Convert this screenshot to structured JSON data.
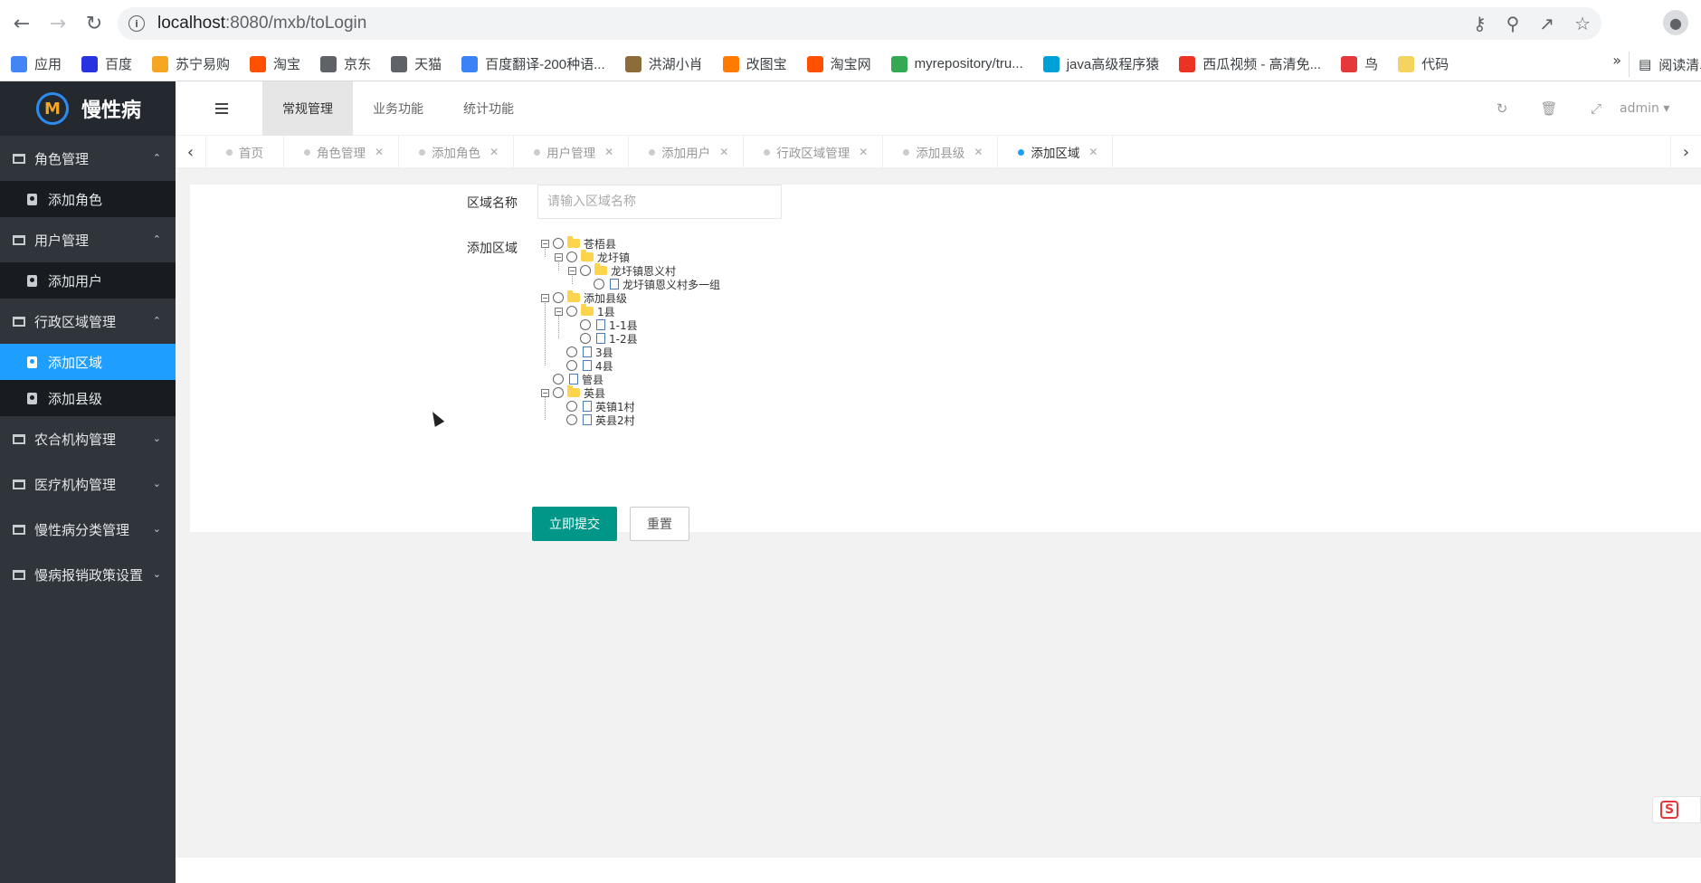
{
  "browser": {
    "url_host": "localhost",
    "url_path": ":8080/mxb/toLogin",
    "bookmarks": [
      {
        "label": "应用",
        "color": "#4285f4",
        "icon": "apps-icon"
      },
      {
        "label": "百度",
        "color": "#2932e1",
        "icon": "baidu-paw-icon"
      },
      {
        "label": "苏宁易购",
        "color": "#f5a623",
        "icon": "suning-icon"
      },
      {
        "label": "淘宝",
        "color": "#ff5000",
        "icon": "taobao-icon"
      },
      {
        "label": "京东",
        "color": "#5f6368",
        "icon": "globe-icon"
      },
      {
        "label": "天猫",
        "color": "#5f6368",
        "icon": "globe-icon"
      },
      {
        "label": "百度翻译-200种语...",
        "color": "#3b82f6",
        "icon": "translate-icon"
      },
      {
        "label": "洪湖小肖",
        "color": "#8a6d3b",
        "icon": "bird-icon"
      },
      {
        "label": "改图宝",
        "color": "#ff7a00",
        "icon": "image-edit-icon"
      },
      {
        "label": "淘宝网",
        "color": "#ff5000",
        "icon": "taobao-icon"
      },
      {
        "label": "myrepository/tru...",
        "color": "#34a853",
        "icon": "chrome-icon"
      },
      {
        "label": "java高级程序猿",
        "color": "#00a1d6",
        "icon": "bilibili-icon"
      },
      {
        "label": "西瓜视频 - 高清免...",
        "color": "#ea3323",
        "icon": "play-icon"
      },
      {
        "label": "鸟",
        "color": "#e5383b",
        "icon": "bird-icon"
      },
      {
        "label": "代码",
        "color": "#f4d35e",
        "icon": "moon-icon"
      }
    ],
    "more_label": "»",
    "reading_list_label": "阅读清单"
  },
  "app": {
    "logo_mark": "M",
    "logo_text": "慢性病",
    "sidebar": [
      {
        "label": "角色管理",
        "expanded": true,
        "children": [
          "添加角色"
        ]
      },
      {
        "label": "用户管理",
        "expanded": true,
        "children": [
          "添加用户"
        ]
      },
      {
        "label": "行政区域管理",
        "expanded": true,
        "children": [
          "添加区域",
          "添加县级"
        ]
      },
      {
        "label": "农合机构管理",
        "expanded": false,
        "children": []
      },
      {
        "label": "医疗机构管理",
        "expanded": false,
        "children": []
      },
      {
        "label": "慢性病分类管理",
        "expanded": false,
        "children": []
      },
      {
        "label": "慢病报销政策设置",
        "expanded": false,
        "children": []
      }
    ],
    "active_child": "添加区域",
    "top_tabs": [
      "常规管理",
      "业务功能",
      "统计功能"
    ],
    "admin_label": "admin",
    "page_tabs": [
      {
        "label": "首页",
        "closable": false
      },
      {
        "label": "角色管理",
        "closable": true
      },
      {
        "label": "添加角色",
        "closable": true
      },
      {
        "label": "用户管理",
        "closable": true
      },
      {
        "label": "添加用户",
        "closable": true
      },
      {
        "label": "行政区域管理",
        "closable": true
      },
      {
        "label": "添加县级",
        "closable": true
      },
      {
        "label": "添加区域",
        "closable": true,
        "active": true
      }
    ]
  },
  "form": {
    "name_label": "区域名称",
    "name_placeholder": "请输入区域名称",
    "name_value": "",
    "area_label": "添加区域",
    "tree": [
      {
        "label": "苍梧县",
        "level": 0,
        "type": "folder"
      },
      {
        "label": "龙圩镇",
        "level": 1,
        "type": "folder"
      },
      {
        "label": "龙圩镇恩义村",
        "level": 2,
        "type": "folder"
      },
      {
        "label": "龙圩镇恩义村多一组",
        "level": 3,
        "type": "file"
      },
      {
        "label": "添加县级",
        "level": 0,
        "type": "folder"
      },
      {
        "label": "1县",
        "level": 1,
        "type": "folder"
      },
      {
        "label": "1-1县",
        "level": 2,
        "type": "file"
      },
      {
        "label": "1-2县",
        "level": 2,
        "type": "file"
      },
      {
        "label": "3县",
        "level": 1,
        "type": "file"
      },
      {
        "label": "4县",
        "level": 1,
        "type": "file"
      },
      {
        "label": "管县",
        "level": 0,
        "type": "file"
      },
      {
        "label": "英县",
        "level": 0,
        "type": "folder"
      },
      {
        "label": "英镇1村",
        "level": 1,
        "type": "file"
      },
      {
        "label": "英县2村",
        "level": 1,
        "type": "file"
      }
    ],
    "submit_label": "立即提交",
    "reset_label": "重置"
  },
  "colors": {
    "sidebar_bg": "#2f353b",
    "sidebar_active": "#1e9fff",
    "primary_button": "#009688"
  }
}
